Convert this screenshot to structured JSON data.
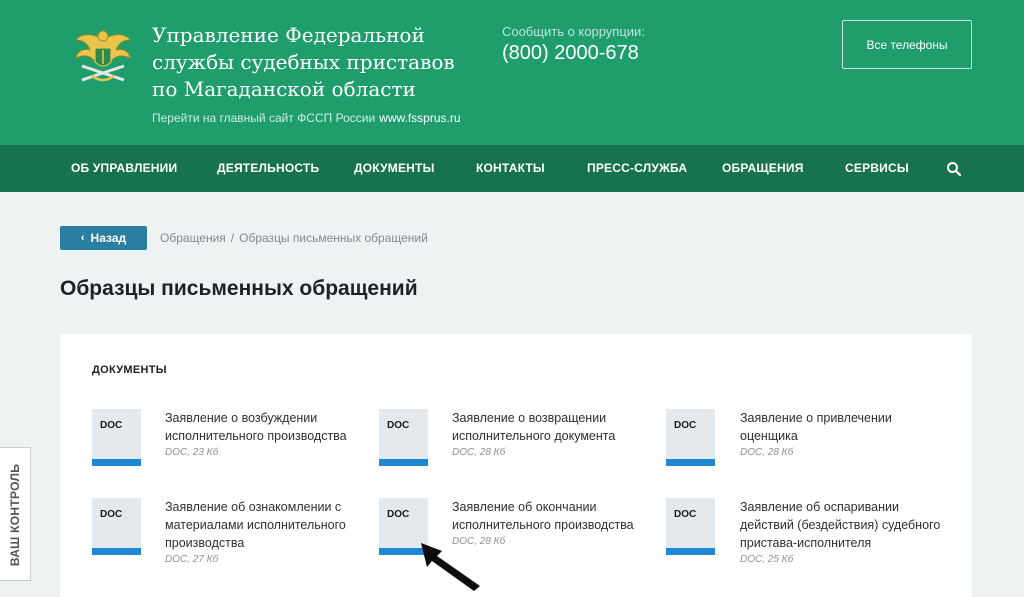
{
  "header": {
    "org_title_lines": [
      "Управление Федеральной",
      "службы судебных приставов",
      "по Магаданской области"
    ],
    "main_site_text": "Перейти на главный сайт ФССП России",
    "main_site_url": "www.fssprus.ru",
    "corruption_label": "Сообщить о коррупции:",
    "corruption_phone": "(800) 2000-678",
    "all_phones_label": "Все телефоны"
  },
  "nav": {
    "items": [
      "ОБ УПРАВЛЕНИИ",
      "ДЕЯТЕЛЬНОСТЬ",
      "ДОКУМЕНТЫ",
      "КОНТАКТЫ",
      "ПРЕСС-СЛУЖБА",
      "ОБРАЩЕНИЯ",
      "СЕРВИСЫ"
    ],
    "search_icon": "search-icon"
  },
  "back": {
    "label": "Назад"
  },
  "breadcrumb": [
    "Обращения",
    "Образцы письменных обращений"
  ],
  "page_title": "Образцы письменных обращений",
  "documents": {
    "section_title": "ДОКУМЕНТЫ",
    "items": [
      {
        "icon_label": "DOC",
        "name_lines": [
          "Заявление о возбуждении",
          "исполнительного производства"
        ],
        "meta": "DOC, 23 Кб"
      },
      {
        "icon_label": "DOC",
        "name_lines": [
          "Заявление о возвращении",
          "исполнительного документа"
        ],
        "meta": "DOC, 28 Кб"
      },
      {
        "icon_label": "DOC",
        "name_lines": [
          "Заявление о привлечении",
          "оценщика"
        ],
        "meta": "DOC, 28 Кб"
      },
      {
        "icon_label": "DOC",
        "name_lines": [
          "Заявление об ознакомлении с",
          "материалами исполнительного",
          "производства"
        ],
        "meta": "DOC, 27 Кб"
      },
      {
        "icon_label": "DOC",
        "name_lines": [
          "Заявление об окончании",
          "исполнительного производства"
        ],
        "meta": "DOC, 28 Кб"
      },
      {
        "icon_label": "DOC",
        "name_lines": [
          "Заявление об оспаривании",
          "действий (бездействия) судебного",
          "пристава-исполнителя"
        ],
        "meta": "DOC, 25 Кб"
      }
    ]
  },
  "side_tab": {
    "label": "ВАШ КОНТРОЛЬ"
  },
  "colors": {
    "header_bg": "#1f9e6c",
    "nav_bg": "#17734f",
    "accent_blue": "#1e88d4",
    "back_button": "#2b7fa3"
  }
}
